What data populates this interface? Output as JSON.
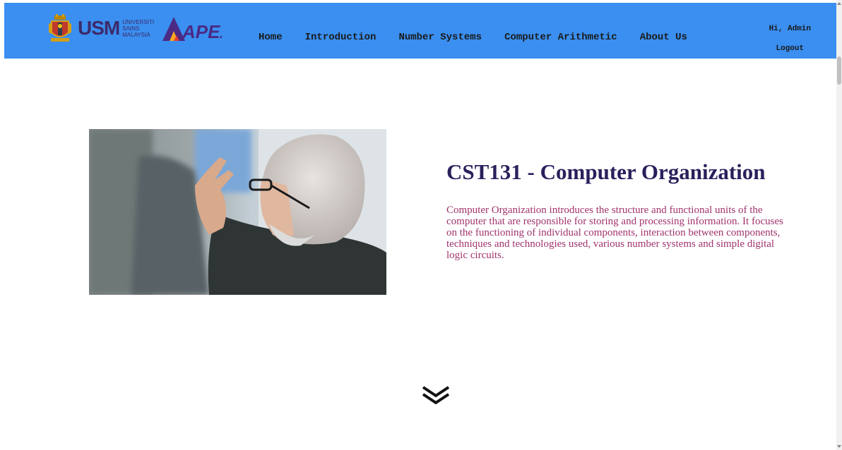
{
  "header": {
    "logo": {
      "usm_text": "USM",
      "usm_sub_lines": [
        "UNIVERSITI",
        "SAINS",
        "MALAYSIA"
      ],
      "apex_text": "APEX"
    },
    "nav": [
      {
        "label": "Home"
      },
      {
        "label": "Introduction"
      },
      {
        "label": "Number Systems"
      },
      {
        "label": "Computer Arithmetic"
      },
      {
        "label": "About Us"
      }
    ],
    "user": {
      "greeting": "Hi, Admin",
      "logout_label": "Logout"
    },
    "bg_color": "#3a8ff0"
  },
  "hero": {
    "image_alt": "lecturer-photo",
    "title": "CST131 - Computer Organization",
    "description": "Computer Organization introduces the structure and functional units of the computer that are responsible for storing and processing information. It focuses on the functioning of individual components, interaction between components, techniques and technologies used, various number systems and simple digital logic circuits.",
    "title_color": "#2b1f5c",
    "text_color": "#a0336d"
  },
  "scroll_indicator": {
    "icon": "double-chevron-down-icon"
  }
}
